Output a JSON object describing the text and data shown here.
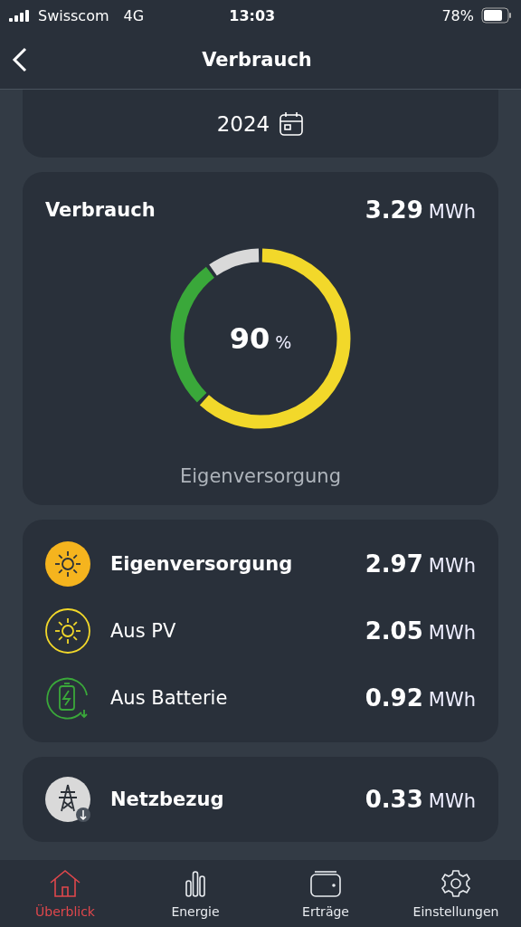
{
  "status_bar": {
    "carrier": "Swisscom",
    "network": "4G",
    "time": "13:03",
    "battery": "78%"
  },
  "header": {
    "title": "Verbrauch"
  },
  "year_picker": {
    "year": "2024"
  },
  "consumption": {
    "title": "Verbrauch",
    "value": "3.29",
    "unit": "MWh",
    "center_value": "90",
    "center_unit": "%",
    "caption": "Eigenversorgung"
  },
  "self_supply": [
    {
      "kind": "sun-filled",
      "label": "Eigenversorgung",
      "value": "2.97",
      "unit": "MWh",
      "color": "#f5b41e"
    },
    {
      "kind": "sun",
      "label": "Aus PV",
      "value": "2.05",
      "unit": "MWh",
      "color": "#f2d82a"
    },
    {
      "kind": "battery",
      "label": "Aus Batterie",
      "value": "0.92",
      "unit": "MWh",
      "color": "#3aa83a"
    }
  ],
  "grid": {
    "kind": "grid",
    "label": "Netzbezug",
    "value": "0.33",
    "unit": "MWh",
    "color": "#d9d9d9"
  },
  "tabs": [
    {
      "label": "Überblick",
      "kind": "home",
      "selected": true
    },
    {
      "label": "Energie",
      "kind": "bars",
      "selected": false
    },
    {
      "label": "Erträge",
      "kind": "wallet",
      "selected": false
    },
    {
      "label": "Einstellungen",
      "kind": "gear",
      "selected": false
    }
  ]
}
